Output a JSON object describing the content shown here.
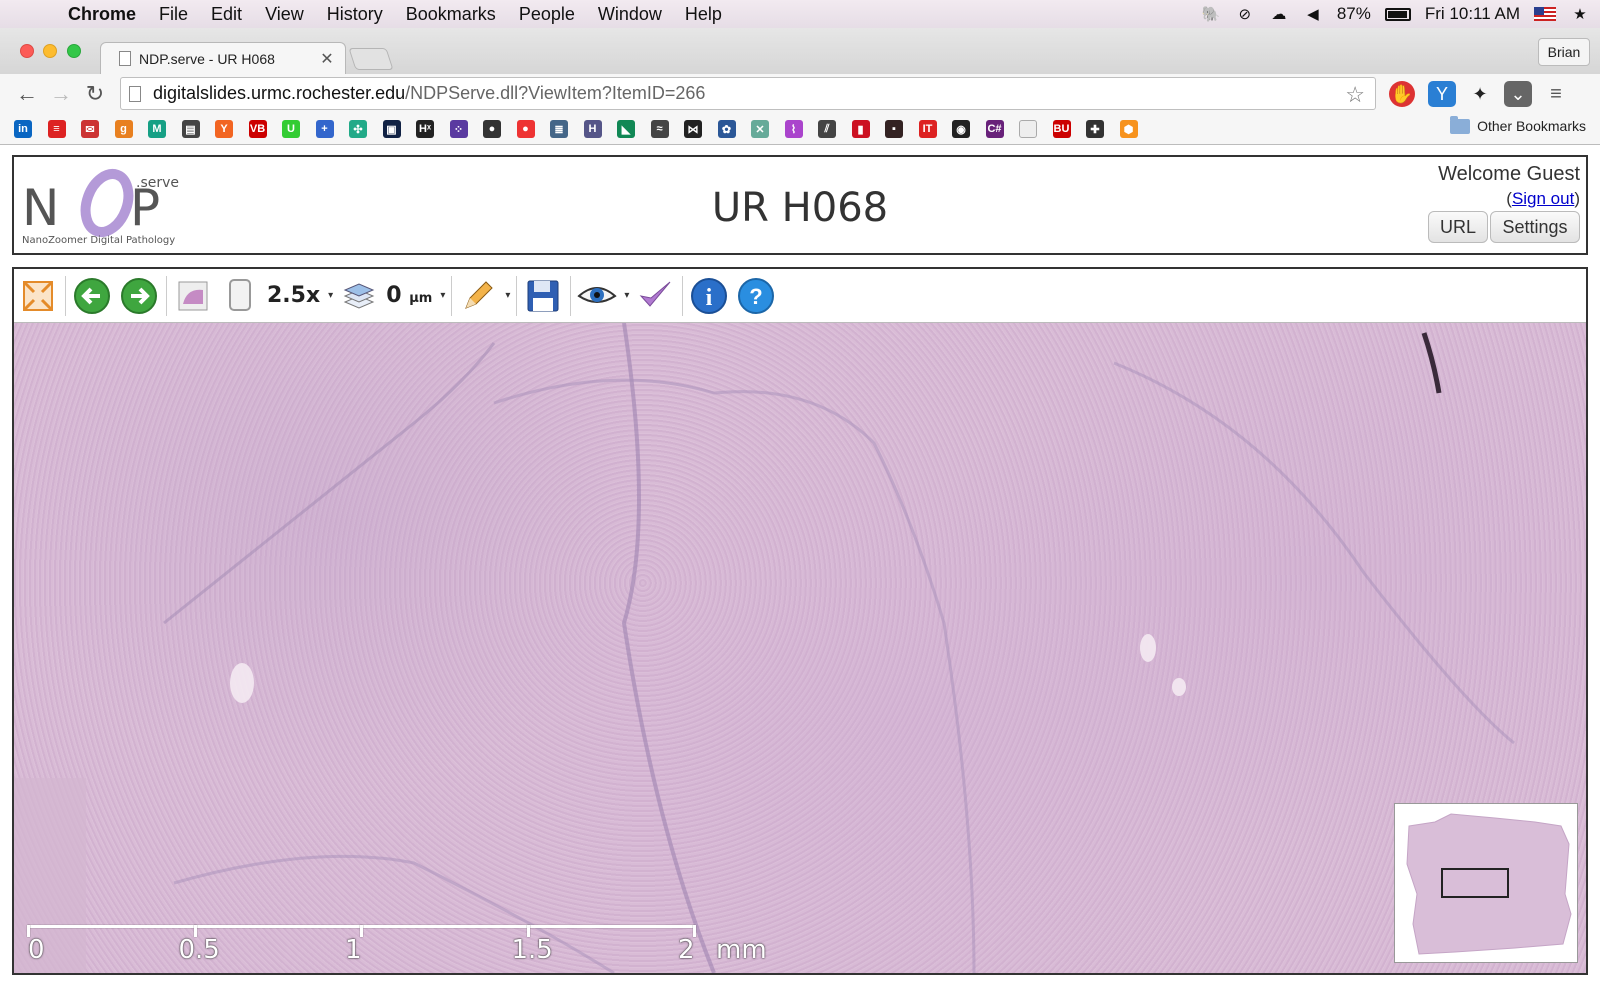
{
  "menubar": {
    "app_name": "Chrome",
    "items": [
      "File",
      "Edit",
      "View",
      "History",
      "Bookmarks",
      "People",
      "Window",
      "Help"
    ],
    "battery": "87%",
    "clock": "Fri 10:11 AM"
  },
  "browser": {
    "tab_title": "NDP.serve - UR H068",
    "profile": "Brian",
    "url_host": "digitalslides.urmc.rochester.edu",
    "url_path": "/NDPServe.dll?ViewItem?ItemID=266",
    "other_bookmarks": "Other Bookmarks",
    "bookmarks": [
      {
        "icon": "linkedin-icon",
        "text": "in",
        "color": "#0a66c2"
      },
      {
        "icon": "stack-icon",
        "text": "≡",
        "color": "#d22"
      },
      {
        "icon": "mail-icon",
        "text": "✉",
        "color": "#c33"
      },
      {
        "icon": "g-icon",
        "text": "g",
        "color": "#e88020"
      },
      {
        "icon": "m-icon",
        "text": "M",
        "color": "#16a085"
      },
      {
        "icon": "news-icon",
        "text": "▤",
        "color": "#444"
      },
      {
        "icon": "ycombinator-icon",
        "text": "Y",
        "color": "#f26522"
      },
      {
        "icon": "vb-icon",
        "text": "VB",
        "color": "#c00"
      },
      {
        "icon": "u-icon",
        "text": "U",
        "color": "#3c3"
      },
      {
        "icon": "plus-icon",
        "text": "+",
        "color": "#36c"
      },
      {
        "icon": "pinwheel-icon",
        "text": "✣",
        "color": "#2a8"
      },
      {
        "icon": "grid-icon",
        "text": "▣",
        "color": "#124"
      },
      {
        "icon": "hx-icon",
        "text": "Hˣ",
        "color": "#222"
      },
      {
        "icon": "dots-icon",
        "text": "⁘",
        "color": "#5a3aa0"
      },
      {
        "icon": "press-icon",
        "text": "●",
        "color": "#333"
      },
      {
        "icon": "tomato-icon",
        "text": "●",
        "color": "#e33"
      },
      {
        "icon": "database-icon",
        "text": "≣",
        "color": "#468"
      },
      {
        "icon": "h-icon",
        "text": "H",
        "color": "#558"
      },
      {
        "icon": "chart-icon",
        "text": "◣",
        "color": "#185"
      },
      {
        "icon": "waves-icon",
        "text": "≈",
        "color": "#444"
      },
      {
        "icon": "bowtie-icon",
        "text": "⋈",
        "color": "#222"
      },
      {
        "icon": "flower-icon",
        "text": "✿",
        "color": "#2b5797"
      },
      {
        "icon": "network-icon",
        "text": "✕",
        "color": "#6a9"
      },
      {
        "icon": "feather-icon",
        "text": "⌇",
        "color": "#a4c"
      },
      {
        "icon": "lines-icon",
        "text": "⫽",
        "color": "#444"
      },
      {
        "icon": "bars-icon",
        "text": "▮",
        "color": "#c12"
      },
      {
        "icon": "dark-icon",
        "text": "▪",
        "color": "#322"
      },
      {
        "icon": "it-icon",
        "text": "IT",
        "color": "#d22"
      },
      {
        "icon": "target-icon",
        "text": "◉",
        "color": "#222"
      },
      {
        "icon": "csharp-icon",
        "text": "C#",
        "color": "#68217a"
      },
      {
        "icon": "page-icon",
        "text": "",
        "color": "#eee"
      },
      {
        "icon": "bu-icon",
        "text": "BU",
        "color": "#c00"
      },
      {
        "icon": "cross-icon",
        "text": "✚",
        "color": "#333"
      },
      {
        "icon": "hexagon-icon",
        "text": "⬢",
        "color": "#f7931e"
      }
    ]
  },
  "header": {
    "logo_text": "NDP",
    "logo_super": ".serve",
    "logo_tagline": "NanoZoomer Digital Pathology",
    "title": "UR H068",
    "welcome": "Welcome Guest",
    "sign_out": "Sign out",
    "url_button": "URL",
    "settings_button": "Settings"
  },
  "viewer": {
    "magnification": "2.5x",
    "focus_value": "0",
    "focus_unit": "µm",
    "scale": {
      "labels": [
        "0",
        "0.5",
        "1",
        "1.5",
        "2"
      ],
      "unit": "mm"
    }
  }
}
